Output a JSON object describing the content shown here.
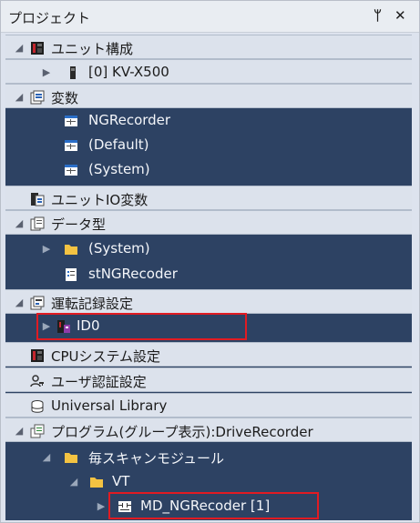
{
  "panel": {
    "title": "プロジェクト",
    "pin_glyph": "ᛘ",
    "close_glyph": "✕"
  },
  "tree": {
    "unit_config": "ユニット構成",
    "unit_kv": "[0]  KV-X500",
    "vars": "変数",
    "ngrecorder": "NGRecorder",
    "default": "(Default)",
    "system": "(System)",
    "unit_io_vars": "ユニットIO変数",
    "data_types": "データ型",
    "dt_system": "(System)",
    "stngrecoder": "stNGRecoder",
    "op_log_settings": "運転記録設定",
    "id0": "ID0",
    "cpu_system": "CPUシステム設定",
    "user_auth": "ユーザ認証設定",
    "universal_lib": "Universal Library",
    "program": "プログラム(グループ表示):DriveRecorder",
    "every_scan": "毎スキャンモジュール",
    "vt": "VT",
    "md_ngrecoder": "MD_NGRecoder [1]"
  },
  "colors": {
    "tree_bg": "#2d4263",
    "row_light": "#dce2ec",
    "highlight": "#e11b22"
  }
}
